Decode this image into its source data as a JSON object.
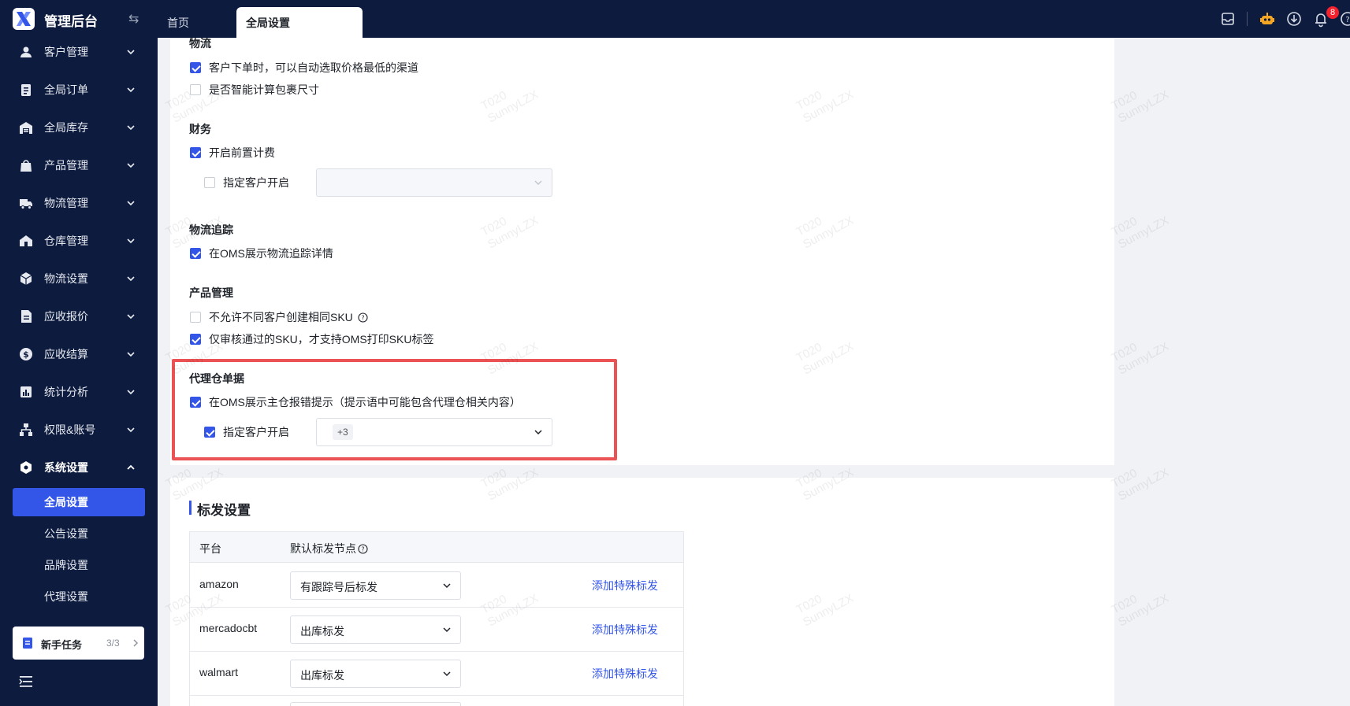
{
  "app": {
    "title": "管理后台",
    "logo_icon": "app-logo",
    "brand_color": "#3355e8",
    "nav_bg": "#0d1b3e"
  },
  "tabs": [
    {
      "label": "首页",
      "active": false
    },
    {
      "label": "全局设置",
      "active": true
    }
  ],
  "header_icons": {
    "notification_count": "8"
  },
  "sidebar": {
    "items": [
      {
        "label": "客户管理",
        "icon": "user-icon",
        "expanded": false
      },
      {
        "label": "全局订单",
        "icon": "clipboard-icon",
        "expanded": false
      },
      {
        "label": "全局库存",
        "icon": "warehouse-icon",
        "expanded": false
      },
      {
        "label": "产品管理",
        "icon": "bag-icon",
        "expanded": false
      },
      {
        "label": "物流管理",
        "icon": "truck-icon",
        "expanded": false
      },
      {
        "label": "仓库管理",
        "icon": "storehouse-icon",
        "expanded": false
      },
      {
        "label": "物流设置",
        "icon": "package-icon",
        "expanded": false
      },
      {
        "label": "应收报价",
        "icon": "document-icon",
        "expanded": false
      },
      {
        "label": "应收结算",
        "icon": "dollar-icon",
        "expanded": false
      },
      {
        "label": "统计分析",
        "icon": "chart-icon",
        "expanded": false
      },
      {
        "label": "权限&账号",
        "icon": "org-icon",
        "expanded": false
      },
      {
        "label": "系统设置",
        "icon": "settings-icon",
        "expanded": true
      }
    ],
    "subitems": [
      {
        "label": "全局设置",
        "active": true
      },
      {
        "label": "公告设置",
        "active": false
      },
      {
        "label": "品牌设置",
        "active": false
      },
      {
        "label": "代理设置",
        "active": false
      }
    ],
    "task_card": {
      "label": "新手任务",
      "count": "3/3"
    }
  },
  "settings": {
    "logistics": {
      "title": "物流",
      "options": [
        {
          "label": "客户下单时，可以自动选取价格最低的渠道",
          "checked": true
        },
        {
          "label": "是否智能计算包裹尺寸",
          "checked": false
        }
      ]
    },
    "finance": {
      "title": "财务",
      "prepay": {
        "label": "开启前置计费",
        "checked": true
      },
      "customer_scope": {
        "label": "指定客户开启",
        "checked": false,
        "select_value": ""
      }
    },
    "tracking": {
      "title": "物流追踪",
      "option": {
        "label": "在OMS展示物流追踪详情",
        "checked": true
      }
    },
    "product": {
      "title": "产品管理",
      "options": [
        {
          "label": "不允许不同客户创建相同SKU",
          "checked": false,
          "has_help": true
        },
        {
          "label": "仅审核通过的SKU，才支持OMS打印SKU标签",
          "checked": true
        }
      ]
    },
    "agent": {
      "title": "代理仓单据",
      "option": {
        "label": "在OMS展示主仓报错提示（提示语中可能包含代理仓相关内容）",
        "checked": true
      },
      "customer_scope": {
        "label": "指定客户开启",
        "checked": true,
        "select_tag": "+3"
      }
    }
  },
  "shipping_mark": {
    "title": "标发设置",
    "columns": [
      "平台",
      "默认标发节点"
    ],
    "rows": [
      {
        "platform": "amazon",
        "node": "有跟踪号后标发",
        "action": "添加特殊标发"
      },
      {
        "platform": "mercadocbt",
        "node": "出库标发",
        "action": "添加特殊标发"
      },
      {
        "platform": "walmart",
        "node": "出库标发",
        "action": "添加特殊标发"
      }
    ]
  },
  "watermark": {
    "line1": "T020",
    "line2": "SunnyLZX"
  }
}
